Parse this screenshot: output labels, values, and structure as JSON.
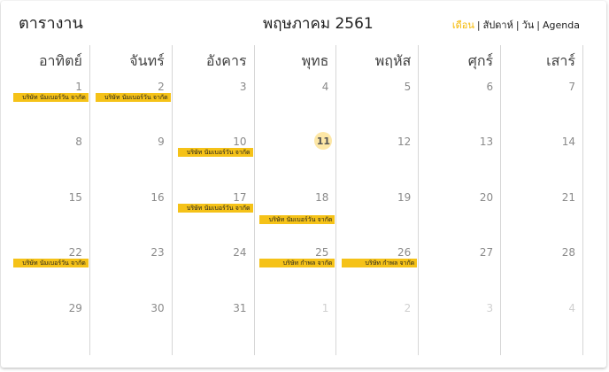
{
  "header": {
    "title": "ตารางาน",
    "month_label": "พฤษภาคม 2561"
  },
  "view_switch": {
    "month": "เดือน",
    "week": "สัปดาห์",
    "day": "วัน",
    "agenda": "Agenda",
    "separator": "|",
    "active": "month",
    "accent_color": "#f5b800"
  },
  "weekdays": [
    "อาทิตย์",
    "จันทร์",
    "อังคาร",
    "พุทธ",
    "พฤหัส",
    "ศุกร์",
    "เสาร์"
  ],
  "event_color": "#f5c218",
  "today_color": "#fde7a6",
  "weeks": [
    [
      {
        "day": "1",
        "event": "บริษัท นัมเบอร์วัน จากัด"
      },
      {
        "day": "2",
        "event": "บริษัท นัมเบอร์วัน จากัด"
      },
      {
        "day": "3"
      },
      {
        "day": "4"
      },
      {
        "day": "5"
      },
      {
        "day": "6"
      },
      {
        "day": "7"
      }
    ],
    [
      {
        "day": "8"
      },
      {
        "day": "9"
      },
      {
        "day": "10",
        "event": "บริษัท นัมเบอร์วัน จากัด"
      },
      {
        "day": "11",
        "today": true
      },
      {
        "day": "12"
      },
      {
        "day": "13"
      },
      {
        "day": "14"
      }
    ],
    [
      {
        "day": "15"
      },
      {
        "day": "16"
      },
      {
        "day": "17",
        "event": "บริษัท นัมเบอร์วัน จากัด"
      },
      {
        "day": "18",
        "event": "บริษัท นัมเบอร์วัน จากัด",
        "event_low": true
      },
      {
        "day": "19"
      },
      {
        "day": "20"
      },
      {
        "day": "21"
      }
    ],
    [
      {
        "day": "22",
        "event": "บริษัท นัมเบอร์วัน จากัด"
      },
      {
        "day": "23"
      },
      {
        "day": "24"
      },
      {
        "day": "25",
        "event": "บริษัท กําพล จากัด"
      },
      {
        "day": "26",
        "event": "บริษัท กําพล จากัด"
      },
      {
        "day": "27"
      },
      {
        "day": "28"
      }
    ],
    [
      {
        "day": "29"
      },
      {
        "day": "30"
      },
      {
        "day": "31"
      },
      {
        "day": "1",
        "muted": true
      },
      {
        "day": "2",
        "muted": true
      },
      {
        "day": "3",
        "muted": true
      },
      {
        "day": "4",
        "muted": true
      }
    ]
  ]
}
